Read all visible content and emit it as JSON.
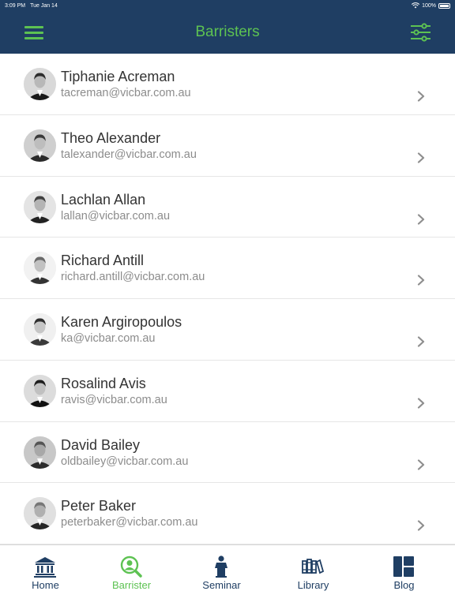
{
  "status_bar": {
    "time": "3:09 PM",
    "date": "Tue Jan 14",
    "battery": "100%"
  },
  "header": {
    "title": "Barristers",
    "menu_icon": "hamburger-menu-icon",
    "filter_icon": "sliders-filter-icon",
    "bar_color": "#1f3e63",
    "accent_color": "#5dc252"
  },
  "barristers": [
    {
      "name": "Tiphanie Acreman",
      "email": "tacreman@vicbar.com.au"
    },
    {
      "name": "Theo Alexander",
      "email": "talexander@vicbar.com.au"
    },
    {
      "name": "Lachlan Allan",
      "email": "lallan@vicbar.com.au"
    },
    {
      "name": "Richard Antill",
      "email": "richard.antill@vicbar.com.au"
    },
    {
      "name": "Karen Argiropoulos",
      "email": "ka@vicbar.com.au"
    },
    {
      "name": "Rosalind Avis",
      "email": "ravis@vicbar.com.au"
    },
    {
      "name": "David Bailey",
      "email": "oldbailey@vicbar.com.au"
    },
    {
      "name": "Peter Baker",
      "email": "peterbaker@vicbar.com.au"
    }
  ],
  "tabs": [
    {
      "label": "Home",
      "icon": "courthouse-icon",
      "active": false
    },
    {
      "label": "Barrister",
      "icon": "person-search-icon",
      "active": true
    },
    {
      "label": "Seminar",
      "icon": "speaker-podium-icon",
      "active": false
    },
    {
      "label": "Library",
      "icon": "books-icon",
      "active": false
    },
    {
      "label": "Blog",
      "icon": "blog-layout-icon",
      "active": false
    }
  ]
}
